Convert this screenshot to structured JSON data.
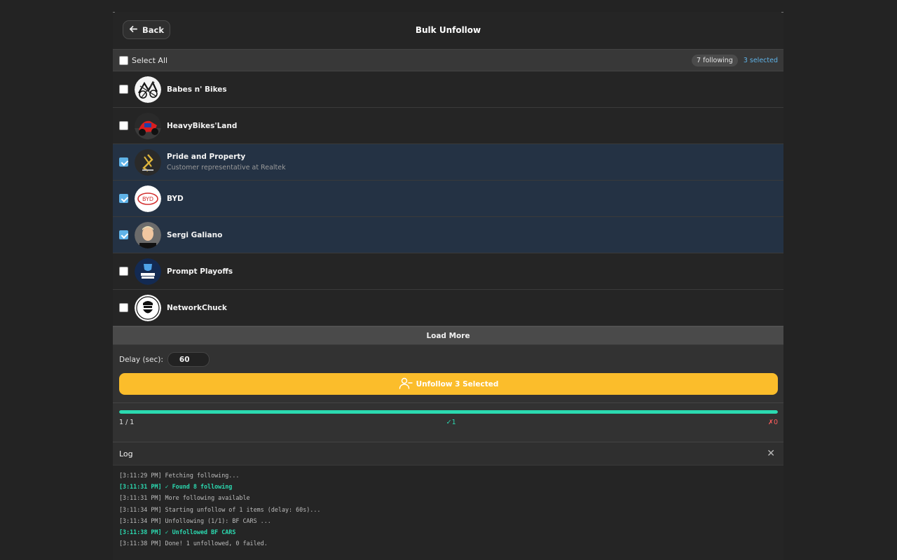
{
  "header": {
    "back_label": "Back",
    "title": "Bulk Unfollow"
  },
  "select_bar": {
    "select_all_label": "Select All",
    "select_all_checked": false,
    "following_count": "7 following",
    "selected_count": "3 selected"
  },
  "accounts": [
    {
      "name": "Babes n' Bikes",
      "subtitle": "",
      "checked": false,
      "avatar_icon": "bike-sketch-avatar"
    },
    {
      "name": "HeavyBikes'Land",
      "subtitle": "",
      "checked": false,
      "avatar_icon": "red-motorcycle-avatar"
    },
    {
      "name": "Pride and Property",
      "subtitle": "Customer representative at Realtek",
      "checked": true,
      "avatar_icon": "gold-logo-avatar"
    },
    {
      "name": "BYD",
      "subtitle": "",
      "checked": true,
      "avatar_icon": "byd-logo-avatar"
    },
    {
      "name": "Sergi Galiano",
      "subtitle": "",
      "checked": true,
      "avatar_icon": "person-photo-avatar"
    },
    {
      "name": "Prompt Playoffs",
      "subtitle": "",
      "checked": false,
      "avatar_icon": "prompt-playoffs-logo-avatar"
    },
    {
      "name": "NetworkChuck",
      "subtitle": "",
      "checked": false,
      "avatar_icon": "networkchuck-logo-avatar"
    }
  ],
  "load_more_label": "Load More",
  "controls": {
    "delay_label": "Delay (sec):",
    "delay_value": "60",
    "unfollow_label": "Unfollow 3 Selected"
  },
  "progress": {
    "fraction": 1.0,
    "count_text": "1 / 1",
    "success_text": "✓1",
    "fail_text": "✗0"
  },
  "log": {
    "title": "Log",
    "close_icon": "close-icon",
    "lines": [
      {
        "text": "[3:11:29 PM] Fetching following...",
        "success": false
      },
      {
        "text": "[3:11:31 PM] ✓ Found 8 following",
        "success": true
      },
      {
        "text": "[3:11:31 PM] More following available",
        "success": false
      },
      {
        "text": "[3:11:34 PM] Starting unfollow of 1 items (delay: 60s)...",
        "success": false
      },
      {
        "text": "[3:11:34 PM] Unfollowing (1/1): BF CARS ...",
        "success": false
      },
      {
        "text": "[3:11:38 PM] ✓ Unfollowed BF CARS",
        "success": true
      },
      {
        "text": "[3:11:38 PM] Done! 1 unfollowed, 0 failed.",
        "success": false
      }
    ]
  },
  "colors": {
    "background": "#232323",
    "accent_blue": "#5fb3e8",
    "selected_row": "#243244",
    "button_yellow": "#fbbd2b",
    "progress_green": "#2bd9b0",
    "fail_red": "#ff5d5d"
  }
}
